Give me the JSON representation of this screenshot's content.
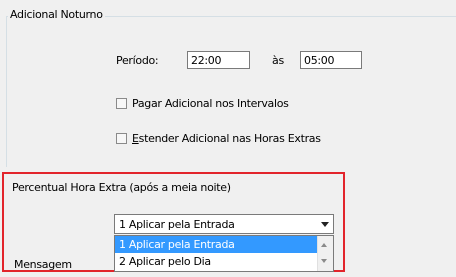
{
  "adicional_noturno": {
    "group_title": "Adicional Noturno",
    "periodo_label": "Período:",
    "start_time": "22:00",
    "as_label": "às",
    "end_time": "05:00",
    "pagar_intervalos_label": "Pagar Adicional nos Intervalos",
    "pagar_intervalos_mnemonic": "A",
    "estender_label_rest": "stender Adicional nas Horas Extras",
    "estender_mnemonic": "E"
  },
  "percentual_hora_extra": {
    "title": "Percentual Hora Extra (após a meia noite)",
    "selected_value": "1 Aplicar pela Entrada",
    "options": [
      "1 Aplicar pela Entrada",
      "2 Aplicar pelo Dia"
    ]
  },
  "mensagem": {
    "label": "Mensagem"
  },
  "colors": {
    "highlight_border": "#e2242b",
    "selection": "#3399ff"
  }
}
